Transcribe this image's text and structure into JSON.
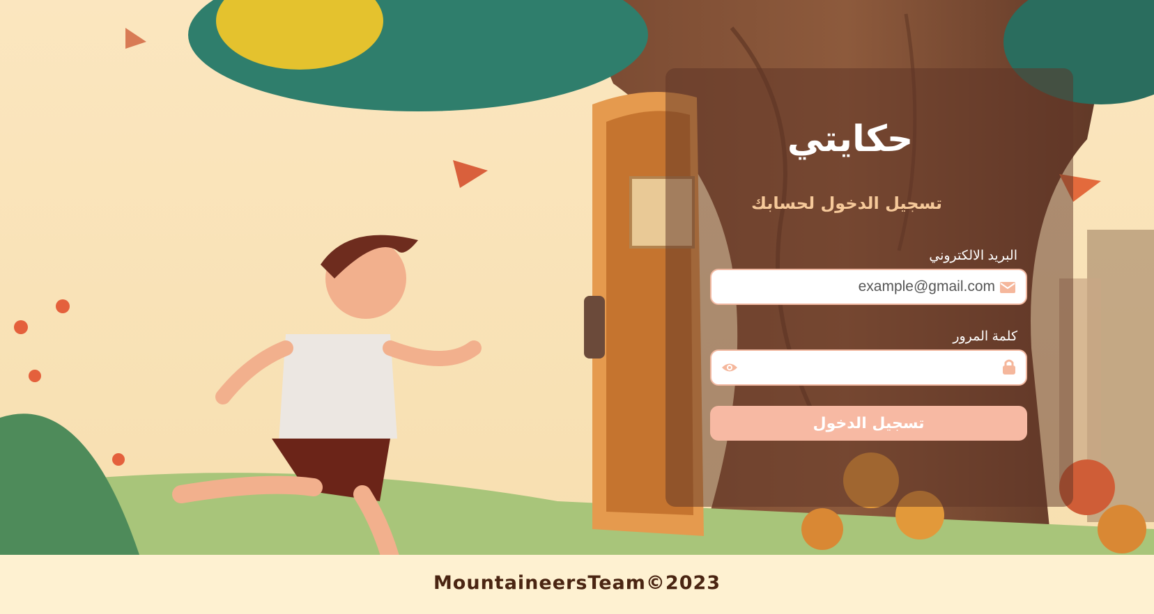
{
  "brand": {
    "name": "حكايتي"
  },
  "login": {
    "title": "تسجيل الدخول لحسابك",
    "email": {
      "label": "البريد الالكتروني",
      "value": "example@gmail.com",
      "icon": "envelope-icon"
    },
    "password": {
      "label": "كلمة المرور",
      "value": "",
      "icons": [
        "eye-icon",
        "lock-icon"
      ]
    },
    "submit_label": "تسجيل الدخول"
  },
  "footer": {
    "text": "MountaineersTeam©2023"
  },
  "colors": {
    "accent": "#f7b9a3",
    "subtitle": "#f6c99a",
    "footer_bg": "#fef1d1",
    "footer_text": "#4a2512"
  }
}
